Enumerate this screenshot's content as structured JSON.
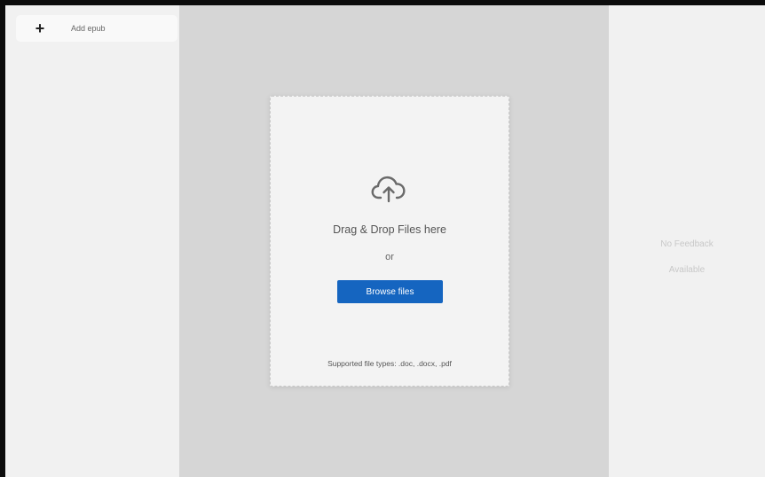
{
  "sidebar": {
    "add_icon": "plus-icon",
    "add_label": "Add epub"
  },
  "upload": {
    "icon": "cloud-upload-icon",
    "drag_text": "Drag & Drop Files here",
    "or_text": "or",
    "browse_label": "Browse files",
    "supported_text": "Supported file types: .doc, .docx, .pdf"
  },
  "feedback": {
    "line1": "No Feedback",
    "line2": "Available"
  },
  "colors": {
    "accent": "#1565c0",
    "center_bg": "#d6d6d6",
    "panel_bg": "#f1f1f1"
  }
}
